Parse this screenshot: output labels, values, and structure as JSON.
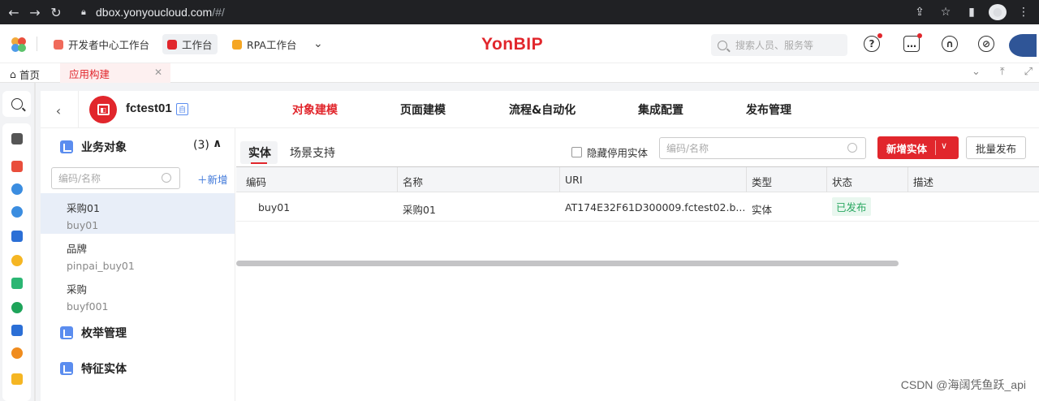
{
  "browser": {
    "url_host": "dbox.yonyoucloud.com",
    "url_path": "/#/"
  },
  "topbar": {
    "tabs": [
      {
        "label": "开发者中心工作台"
      },
      {
        "label": "工作台"
      },
      {
        "label": "RPA工作台"
      }
    ],
    "brand": "YonBIP",
    "search_placeholder": "搜索人员、服务等"
  },
  "tabstrip": {
    "home_label": "首页",
    "app_tab_label": "应用构建"
  },
  "app": {
    "name": "fctest01",
    "badge": "自",
    "nav": [
      {
        "label": "对象建模"
      },
      {
        "label": "页面建模"
      },
      {
        "label": "流程&自动化"
      },
      {
        "label": "集成配置"
      },
      {
        "label": "发布管理"
      }
    ]
  },
  "sidebar": {
    "group_business": "业务对象",
    "group_business_count": "(3)",
    "search_placeholder": "编码/名称",
    "add_label": "新增",
    "items": [
      {
        "name": "采购01",
        "code": "buy01"
      },
      {
        "name": "品牌",
        "code": "pinpai_buy01"
      },
      {
        "name": "采购",
        "code": "buyf001"
      }
    ],
    "group_enum": "枚举管理",
    "group_feature": "特征实体"
  },
  "content": {
    "tabs": [
      {
        "label": "实体"
      },
      {
        "label": "场景支持"
      }
    ],
    "hide_disabled_label": "隐藏停用实体",
    "search_placeholder": "编码/名称",
    "new_entity_label": "新增实体",
    "bulk_publish_label": "批量发布",
    "columns": [
      "编码",
      "名称",
      "URI",
      "类型",
      "状态",
      "描述"
    ],
    "rows": [
      {
        "code": "buy01",
        "name": "采购01",
        "uri": "AT174E32F61D300009.fctest02.b...",
        "type": "实体",
        "status": "已发布",
        "desc": ""
      }
    ]
  },
  "watermark": "CSDN @海阔凭鱼跃_api",
  "colors": {
    "accent": "#e1262c",
    "link": "#3b75d9",
    "status_published": "#2aa861"
  }
}
